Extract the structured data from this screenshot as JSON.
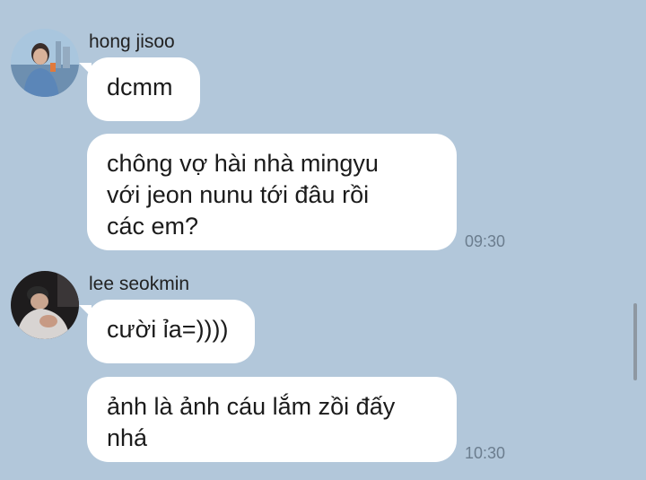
{
  "chat": {
    "groups": [
      {
        "sender": "hong jisoo",
        "avatar_icon": "user-avatar-photo",
        "messages": [
          {
            "text": "dcmm",
            "time": ""
          },
          {
            "text": "chông vợ hài nhà mingyu\nvới jeon nunu tới đâu rồi\ncác em?",
            "time": "09:30"
          }
        ]
      },
      {
        "sender": "lee seokmin",
        "avatar_icon": "user-avatar-photo",
        "messages": [
          {
            "text": "cười ỉa=))))",
            "time": ""
          },
          {
            "text": "ảnh là ảnh cáu lắm zồi đấy\nnhá",
            "time": "10:30"
          }
        ]
      }
    ]
  },
  "colors": {
    "background": "#b2c7da",
    "bubble": "#ffffff",
    "timestamp": "#6b7d8e"
  }
}
